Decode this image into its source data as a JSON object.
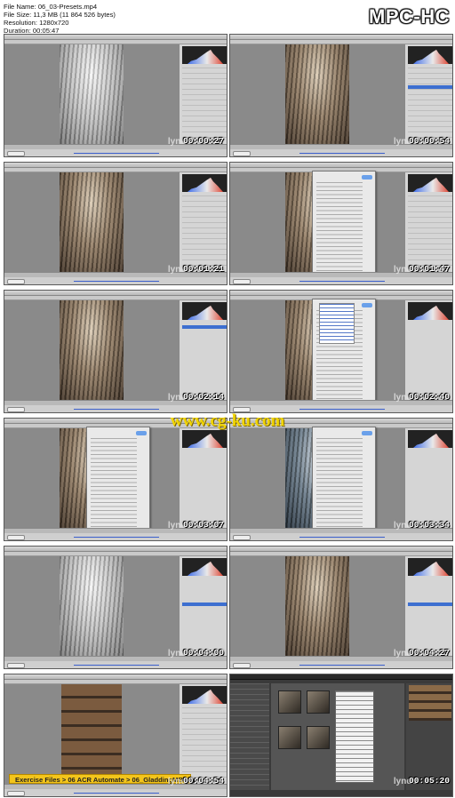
{
  "info": {
    "file_name": "File Name: 06_03-Presets.mp4",
    "file_size": "File Size: 11,3 MB (11 864 526 bytes)",
    "resolution": "Resolution: 1280x720",
    "duration": "Duration: 00:05:47"
  },
  "logo": "MPC-HC",
  "watermark": "www.cg-ku.com",
  "brand": "lynda",
  "frames": [
    {
      "time": "00:00:27"
    },
    {
      "time": "00:00:54"
    },
    {
      "time": "00:01:21"
    },
    {
      "time": "00:01:47"
    },
    {
      "time": "00:02:14"
    },
    {
      "time": "00:02:40"
    },
    {
      "time": "00:03:07"
    },
    {
      "time": "00:03:34"
    },
    {
      "time": "00:04:00"
    },
    {
      "time": "00:04:27"
    },
    {
      "time": "00:04:54"
    },
    {
      "time": "00:05:20"
    }
  ],
  "breadcrumb": "Exercise Files > 06 ACR Automate > 06_GladdingMB.jpg"
}
